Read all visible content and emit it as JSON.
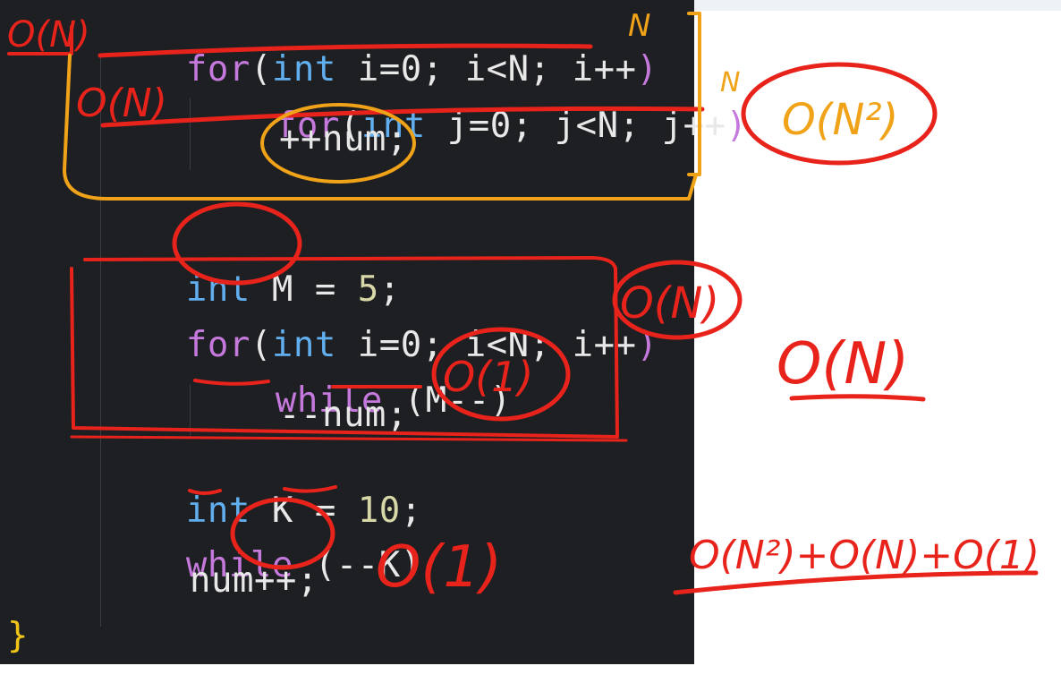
{
  "code": {
    "line1": {
      "kw": "for",
      "paren": "(",
      "type": "int",
      "rest": " i=0; i<N; i++",
      "close": ")"
    },
    "line2": {
      "kw": "for",
      "paren": "(",
      "type": "int",
      "rest": " j=0; j<N; j++",
      "close": ")"
    },
    "line3": "++num;",
    "line5": {
      "type": "int",
      "name": " M = ",
      "num": "5",
      "end": ";"
    },
    "line6": {
      "kw": "for",
      "paren": "(",
      "type": "int",
      "rest": " i=0; i<N; i++",
      "close": ")"
    },
    "line7": {
      "kw": "while",
      "rest": " (M--)"
    },
    "line8": "--num;",
    "line9": {
      "type": "int",
      "name": " K = ",
      "num": "10",
      "end": ";"
    },
    "line10": {
      "kw": "while",
      "rest": " (--K)"
    },
    "line11": "num++;",
    "line12": "}"
  },
  "annotations": {
    "top_left_ON": "O(N)",
    "inner_ON": "O(N)",
    "N_marker_top": "N",
    "N_marker_right": "N",
    "quad": "O(N²)",
    "loop2": "O(N)",
    "while_O1": "O(1)",
    "middle_ON": "O(N)",
    "bottom_O1": "O(1)",
    "sum": "O(N²)+O(N)+O(1)"
  },
  "colors": {
    "editor_bg": "#1e1f22",
    "keyword": "#c679dd",
    "type": "#61afef",
    "number": "#d7d7a8",
    "ink_red": "#e8231b",
    "ink_orange": "#f0a318"
  }
}
